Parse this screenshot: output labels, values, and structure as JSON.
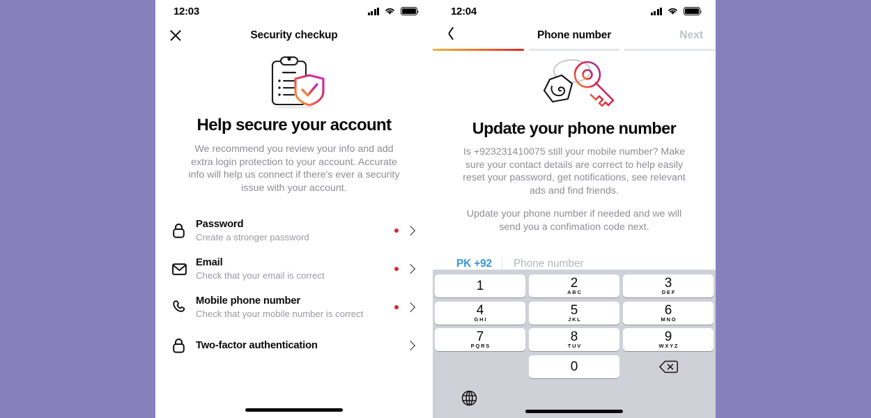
{
  "theme": {
    "page_background": "#8681bd",
    "accent_blue": "#3897d8",
    "alert_dot": "#d42a2a",
    "progress_gradient_start": "#f5b23a",
    "progress_gradient_end": "#d92b2b",
    "keypad_background": "#ced1d8"
  },
  "left_phone": {
    "status": {
      "time": "12:03",
      "signal_icon": "signal-bars-icon",
      "wifi_icon": "wifi-icon",
      "battery_icon": "battery-full-icon"
    },
    "nav": {
      "close_icon": "close-icon",
      "title": "Security checkup"
    },
    "illustration": "clipboard-shield-checkmark-illustration",
    "heading": "Help secure your account",
    "description": "We recommend you review your info and add extra login protection to your account. Accurate info will help us connect if there's ever a security issue with your account.",
    "items": [
      {
        "icon": "lock-icon",
        "title": "Password",
        "subtitle": "Create a stronger password",
        "has_alert_dot": true,
        "chevron": "chevron-right-icon"
      },
      {
        "icon": "envelope-icon",
        "title": "Email",
        "subtitle": "Check that your email is correct",
        "has_alert_dot": true,
        "chevron": "chevron-right-icon"
      },
      {
        "icon": "phone-handset-icon",
        "title": "Mobile phone number",
        "subtitle": "Check that your mobile number is correct",
        "has_alert_dot": true,
        "chevron": "chevron-right-icon"
      },
      {
        "icon": "lock-icon",
        "title": "Two-factor authentication",
        "subtitle": "",
        "has_alert_dot": false,
        "chevron": "chevron-right-icon"
      }
    ],
    "home_indicator": "home-indicator"
  },
  "right_phone": {
    "status": {
      "time": "12:04",
      "signal_icon": "signal-bars-icon",
      "wifi_icon": "wifi-icon",
      "battery_icon": "battery-full-icon"
    },
    "nav": {
      "back_icon": "chevron-left-icon",
      "title": "Phone number",
      "next_label": "Next"
    },
    "progress": {
      "total_steps": 3,
      "current_step": 1
    },
    "illustration": "key-tag-phone-illustration",
    "heading": "Update your phone number",
    "description_1": "Is +923231410075 still your mobile number? Make sure your contact details are correct to help easily reset your password, get notifications, see relevant ads and find friends.",
    "description_2": "Update your phone number if needed and we will send you a confimation code next.",
    "phone_input": {
      "country_code": "PK +92",
      "value": "",
      "placeholder": "Phone number"
    },
    "keypad": {
      "keys": [
        {
          "num": "1",
          "letters": ""
        },
        {
          "num": "2",
          "letters": "ABC"
        },
        {
          "num": "3",
          "letters": "DEF"
        },
        {
          "num": "4",
          "letters": "GHI"
        },
        {
          "num": "5",
          "letters": "JKL"
        },
        {
          "num": "6",
          "letters": "MNO"
        },
        {
          "num": "7",
          "letters": "PQRS"
        },
        {
          "num": "8",
          "letters": "TUV"
        },
        {
          "num": "9",
          "letters": "WXYZ"
        },
        {
          "num": "0",
          "letters": ""
        }
      ],
      "delete_icon": "backspace-delete-icon",
      "globe_icon": "globe-language-icon"
    },
    "home_indicator": "home-indicator"
  }
}
